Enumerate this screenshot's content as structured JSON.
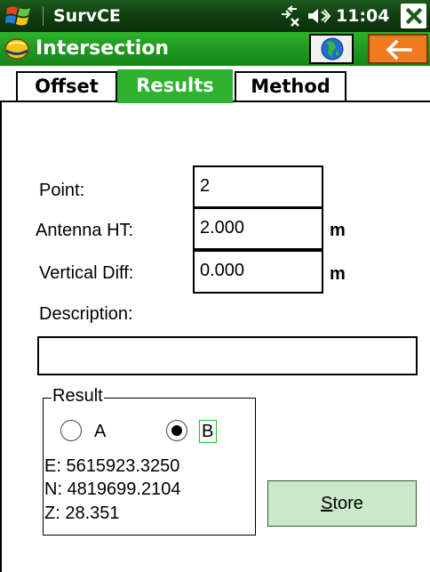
{
  "status_bar": {
    "app_name": "SurvCE",
    "time": "11:04"
  },
  "title_bar": {
    "title": "Intersection"
  },
  "tabs": [
    {
      "label": "Offset"
    },
    {
      "label": "Results",
      "selected": true
    },
    {
      "label": "Method"
    }
  ],
  "form": {
    "point": {
      "label": "Point:",
      "value": "2"
    },
    "antenna_ht": {
      "label": "Antenna HT:",
      "value": "2.000",
      "unit": "m"
    },
    "vertical_diff": {
      "label": "Vertical Diff:",
      "value": "0.000",
      "unit": "m"
    },
    "description": {
      "label": "Description:",
      "value": ""
    }
  },
  "result": {
    "group_label": "Result",
    "option_a": "A",
    "option_b": "B",
    "selected": "B",
    "easting": "E: 5615923.3250",
    "northing": "N: 4819699.2104",
    "elevation": "Z: 28.351"
  },
  "store_button": {
    "first_letter": "S",
    "rest": "tore"
  },
  "colors": {
    "accent_green": "#2db32d",
    "statusbar_green": "#1c5a1c",
    "back_orange": "#f07a20",
    "button_green": "#c9e9c9"
  },
  "icons": [
    "windows-start-icon",
    "network-icon",
    "volume-icon",
    "close-icon",
    "helmet-app-icon",
    "globe-icon",
    "back-arrow-icon"
  ]
}
